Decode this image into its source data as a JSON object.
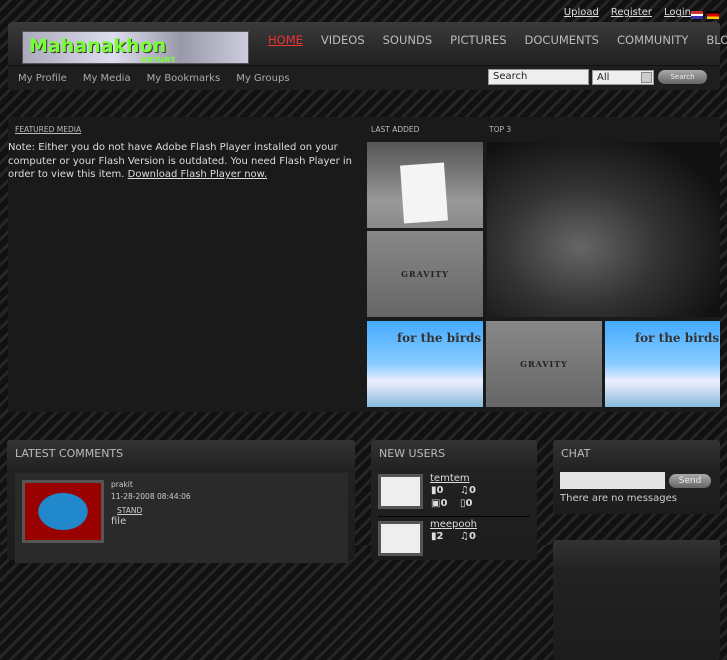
{
  "top_links": [
    "Upload",
    "Register",
    "Login"
  ],
  "languages": [
    "en",
    "de"
  ],
  "logo": {
    "text": "Mahanakhon",
    "sub": "มหานคร"
  },
  "nav": [
    {
      "label": "HOME",
      "active": true
    },
    {
      "label": "VIDEOS"
    },
    {
      "label": "SOUNDS"
    },
    {
      "label": "PICTURES"
    },
    {
      "label": "DOCUMENTS"
    },
    {
      "label": "COMMUNITY"
    },
    {
      "label": "BLOG"
    }
  ],
  "subnav": [
    "My Profile",
    "My Media",
    "My Bookmarks",
    "My Groups"
  ],
  "search": {
    "value": "Search",
    "filter": "All",
    "button": "Search"
  },
  "featured": {
    "title": "FEATURED MEDIA",
    "note": "Note: Either you do not have Adobe Flash Player installed on your computer or your Flash Version is outdated. You need Flash Player in order to view this item. ",
    "link": "Download Flash Player now."
  },
  "last_added_title": "LAST ADDED",
  "top3_title": "TOP 3",
  "thumb_text": {
    "gravity": "GRAVITY",
    "birds": "for the birds"
  },
  "latest_comments": {
    "title": "LATEST COMMENTS",
    "items": [
      {
        "user": "prakit",
        "date": "11-28-2008 08:44:06",
        "link": "STAND ",
        "text": "file "
      }
    ]
  },
  "new_users": {
    "title": "NEW USERS",
    "items": [
      {
        "name": "temtem",
        "videos": "0",
        "sounds": "0",
        "pictures": "0",
        "documents": "0"
      },
      {
        "name": "meepooh",
        "videos": "2",
        "sounds": "0"
      }
    ]
  },
  "chat": {
    "title": "CHAT",
    "send": "Send",
    "empty": "There are no messages"
  },
  "colors": {
    "accent": "#e33333"
  }
}
